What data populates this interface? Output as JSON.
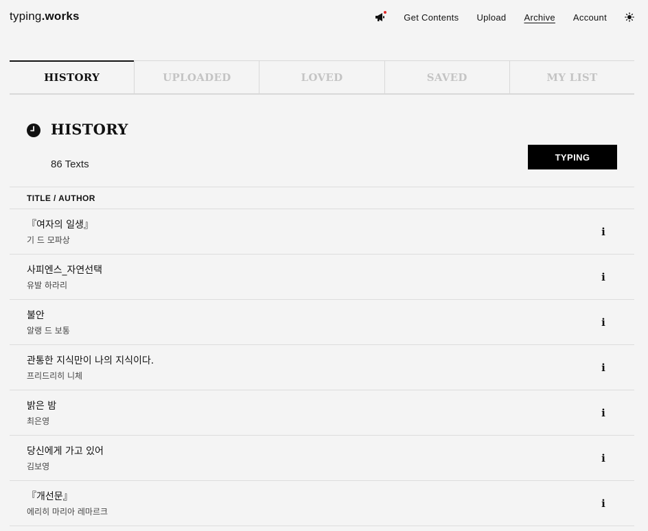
{
  "header": {
    "logo_prefix": "typing",
    "logo_suffix": ".works",
    "nav": {
      "get_contents": "Get Contents",
      "upload": "Upload",
      "archive": "Archive",
      "account": "Account"
    }
  },
  "tabs": [
    {
      "label": "HISTORY",
      "active": true
    },
    {
      "label": "UPLOADED"
    },
    {
      "label": "LOVED"
    },
    {
      "label": "SAVED"
    },
    {
      "label": "MY LIST"
    }
  ],
  "section": {
    "title": "HISTORY",
    "count": "86 Texts",
    "typing_button": "TYPING",
    "column_header": "TITLE / AUTHOR"
  },
  "rows": [
    {
      "title": "『여자의 일생』",
      "author": "기 드 모파상",
      "info": "i"
    },
    {
      "title": "사피엔스_자연선택",
      "author": "유발 하라리",
      "info": "i"
    },
    {
      "title": "불안",
      "author": "알랭 드 보통",
      "info": "i"
    },
    {
      "title": "관통한 지식만이 나의 지식이다.",
      "author": "프리드리히 니체",
      "info": "i"
    },
    {
      "title": "밝은 밤",
      "author": "최은영",
      "info": "i"
    },
    {
      "title": "당신에게 가고 있어",
      "author": "김보영",
      "info": "i"
    },
    {
      "title": "『개선문』",
      "author": "에리히 마리아 레마르크",
      "info": "i"
    }
  ],
  "colors": {
    "background": "#f4f4f4",
    "text": "#111111",
    "notification_dot": "#e02828",
    "inactive_tab": "#c4c4c4",
    "button": "#000000"
  },
  "icons": {
    "notice": "megaphone-icon",
    "theme": "sun-icon",
    "section": "clock-icon"
  }
}
